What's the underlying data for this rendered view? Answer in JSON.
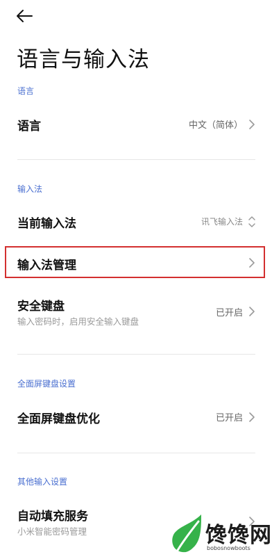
{
  "header": {
    "title": "语言与输入法"
  },
  "sections": [
    {
      "header": "语言",
      "rows": [
        {
          "title": "语言",
          "value": "中文（简体）"
        }
      ]
    },
    {
      "header": "输入法",
      "rows": [
        {
          "title": "当前输入法",
          "value": "讯飞输入法"
        },
        {
          "title": "输入法管理"
        },
        {
          "title": "安全键盘",
          "subtitle": "输入密码时，启用安全输入键盘",
          "value": "已开启"
        }
      ]
    },
    {
      "header": "全面屏键盘设置",
      "rows": [
        {
          "title": "全面屏键盘优化",
          "value": "已开启"
        }
      ]
    },
    {
      "header": "其他输入设置",
      "rows": [
        {
          "title": "自动填充服务",
          "subtitle": "小米智能密码管理"
        }
      ]
    }
  ],
  "watermark": {
    "text": "馋馋网",
    "url": "bobosnowboots"
  },
  "colors": {
    "section_header": "#4a6fd0",
    "highlight": "#d32f2f",
    "logo_green": "#36b24a"
  }
}
